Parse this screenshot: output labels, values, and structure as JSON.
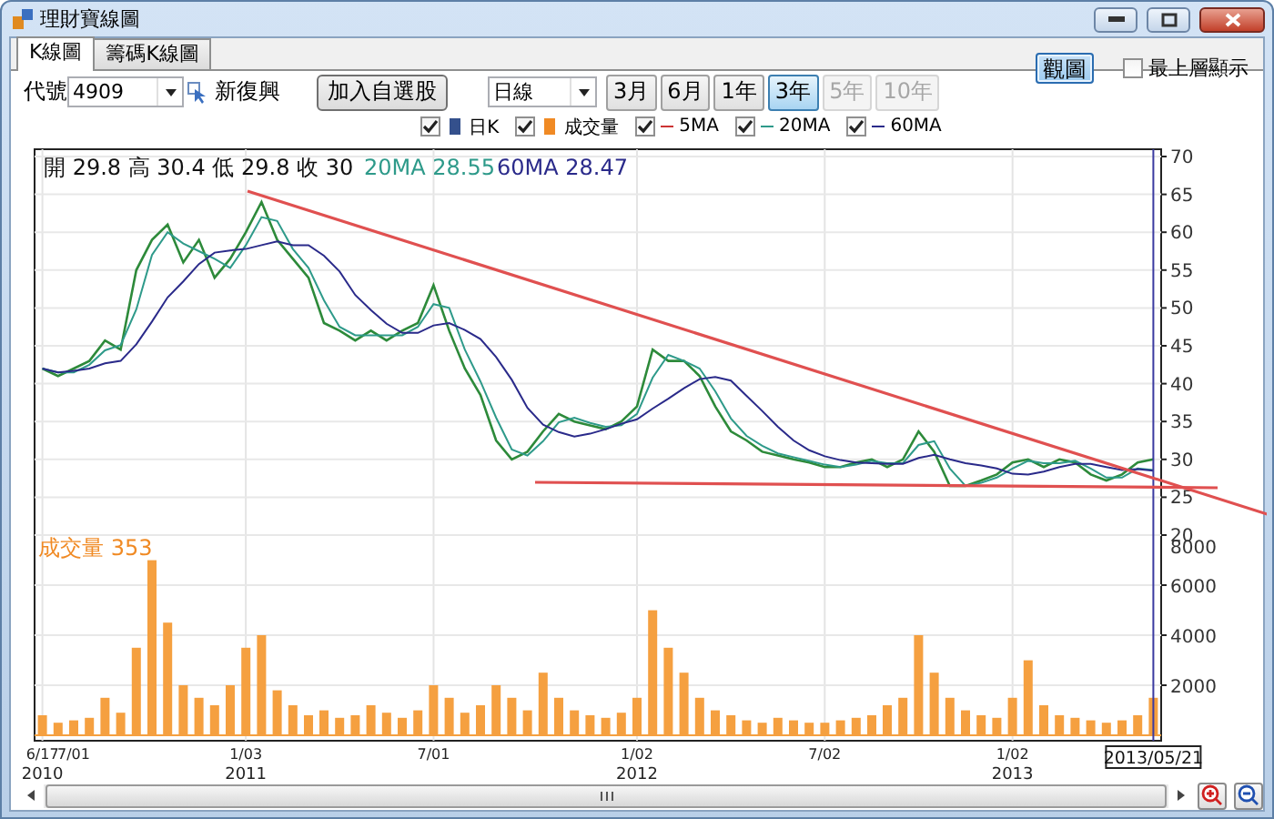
{
  "window": {
    "title": "理財寶線圖"
  },
  "tabs": [
    {
      "label": "K線圖",
      "selected": true
    },
    {
      "label": "籌碼K線圖",
      "selected": false
    }
  ],
  "view_button": {
    "label": "觀圖",
    "highlighted": true
  },
  "always_on_top": {
    "label": "最上層顯示",
    "checked": false
  },
  "toolbar": {
    "code_label": "代號",
    "code": {
      "value": "4909"
    },
    "stock_name": "新復興",
    "add_button": "加入自選股",
    "interval": {
      "value": "日線"
    },
    "periods": [
      {
        "label": "3月",
        "selected": false,
        "disabled": false
      },
      {
        "label": "6月",
        "selected": false,
        "disabled": false
      },
      {
        "label": "1年",
        "selected": false,
        "disabled": false
      },
      {
        "label": "3年",
        "selected": true,
        "disabled": false
      },
      {
        "label": "5年",
        "selected": false,
        "disabled": true
      },
      {
        "label": "10年",
        "selected": false,
        "disabled": true
      }
    ]
  },
  "legend": [
    {
      "label": "日K",
      "checked": true,
      "kind": "square",
      "color": "#34508c"
    },
    {
      "label": "成交量",
      "checked": true,
      "kind": "square",
      "color": "#f08a24"
    },
    {
      "label": "5MA",
      "checked": true,
      "kind": "line",
      "color": "#cc3333"
    },
    {
      "label": "20MA",
      "checked": true,
      "kind": "line",
      "color": "#2e9a8a"
    },
    {
      "label": "60MA",
      "checked": true,
      "kind": "line",
      "color": "#2a2a8a"
    }
  ],
  "price_panel": {
    "quote": "開 29.8 高 30.4 低 29.8 收 30",
    "ma_readings": [
      {
        "text": "20MA 28.55",
        "color": "#2e9a8a"
      },
      {
        "text": "60MA 28.47",
        "color": "#2a2a8a"
      }
    ],
    "cursor_label": "2013/05/21",
    "chart_data": {
      "type": "line",
      "ylim": [
        20,
        70
      ],
      "yticks": [
        20,
        25,
        30,
        35,
        40,
        45,
        50,
        55,
        60,
        65,
        70
      ],
      "grid": true,
      "series": [
        {
          "color": "#2d8a3a",
          "values": [
            42,
            41,
            42,
            43,
            45.7,
            44.5,
            55,
            59,
            61,
            56,
            59,
            54,
            56.5,
            60,
            64,
            59,
            56.5,
            54,
            48,
            47,
            45.7,
            47,
            45.7,
            47,
            48,
            53,
            47,
            42,
            38.5,
            32.5,
            30,
            31,
            33.7,
            36,
            35,
            34.5,
            34,
            35,
            37,
            44.5,
            43,
            43,
            41,
            37,
            33.7,
            32.5,
            31,
            30.5,
            30,
            29.6,
            29,
            29,
            29.6,
            30,
            29,
            30,
            33.7,
            31,
            26.5,
            26.5,
            27.2,
            28,
            29.6,
            30,
            29,
            30,
            29.6,
            28,
            27.2,
            28,
            29.6,
            30
          ]
        },
        {
          "color": "#2e9a8a",
          "values": [
            42,
            41.5,
            41.5,
            42.5,
            44.4,
            45.1,
            49.8,
            57,
            60,
            58.5,
            57.5,
            56.5,
            55.3,
            58.3,
            62,
            61.5,
            57.8,
            55.3,
            51,
            47.5,
            46.4,
            46.4,
            46.4,
            46.4,
            47.5,
            50.5,
            50,
            44.5,
            40.3,
            35.5,
            31.3,
            30.5,
            32.4,
            34.9,
            35.5,
            34.8,
            34.3,
            34.5,
            36,
            40.8,
            43.8,
            43,
            42,
            39,
            35.4,
            33.1,
            31.8,
            30.8,
            30.3,
            29.8,
            29.3,
            29,
            29.3,
            29.8,
            29.5,
            29.5,
            31.9,
            32.4,
            28.8,
            26.5,
            26.9,
            27.6,
            28.8,
            29.8,
            29.5,
            29.5,
            29.8,
            28.8,
            27.6,
            27.6,
            28.8,
            28.6
          ]
        },
        {
          "color": "#2a2a8a",
          "values": [
            42,
            41.5,
            41.7,
            42,
            42.7,
            43,
            45.2,
            48.2,
            51.4,
            53.5,
            55.8,
            57.3,
            57.6,
            57.8,
            58.3,
            58.8,
            58.3,
            58.3,
            56.9,
            54.8,
            51.7,
            49.7,
            47.9,
            46.7,
            46.7,
            47.7,
            48,
            47.1,
            45.9,
            43.5,
            40.5,
            36.8,
            34.6,
            33.6,
            33,
            33.4,
            34,
            34.7,
            35.3,
            36.7,
            38,
            39.4,
            40.6,
            40.9,
            40.4,
            38.4,
            36.4,
            34.3,
            32.5,
            31.2,
            30.4,
            29.9,
            29.6,
            29.5,
            29.4,
            29.4,
            30.2,
            30.6,
            30,
            29.5,
            29.2,
            28.8,
            28.1,
            28,
            28.4,
            29,
            29.4,
            29.4,
            29,
            28.6,
            28.7,
            28.5
          ]
        }
      ]
    }
  },
  "volume_panel": {
    "label": "成交量 353",
    "year_labels": [
      "2010",
      "2011",
      "2012",
      "2013"
    ],
    "chart_data": {
      "type": "bar",
      "ylim": [
        0,
        8000
      ],
      "yticks": [
        2000,
        4000,
        6000,
        8000
      ],
      "grid": true,
      "categories": [
        "6/17",
        null,
        "7/01",
        null,
        null,
        null,
        null,
        null,
        null,
        null,
        null,
        null,
        null,
        "1/03",
        null,
        null,
        null,
        null,
        null,
        null,
        null,
        null,
        null,
        null,
        null,
        "7/01",
        null,
        null,
        null,
        null,
        null,
        null,
        null,
        null,
        null,
        null,
        null,
        null,
        "1/02",
        null,
        null,
        null,
        null,
        null,
        null,
        null,
        null,
        null,
        null,
        null,
        "7/02",
        null,
        null,
        null,
        null,
        null,
        null,
        null,
        null,
        null,
        null,
        null,
        "1/02",
        null,
        null,
        null,
        null,
        null,
        null,
        null,
        null,
        null
      ],
      "series": [
        {
          "color": "#f5a040",
          "values": [
            800,
            500,
            600,
            700,
            1500,
            900,
            3500,
            7000,
            4500,
            2000,
            1500,
            1200,
            2000,
            3500,
            4000,
            1800,
            1200,
            800,
            1000,
            700,
            800,
            1200,
            900,
            700,
            1000,
            2000,
            1500,
            900,
            1200,
            2000,
            1500,
            1000,
            2500,
            1500,
            1000,
            800,
            700,
            900,
            1500,
            5000,
            3500,
            2500,
            1500,
            1000,
            800,
            600,
            500,
            700,
            600,
            500,
            500,
            600,
            700,
            800,
            1200,
            1500,
            4000,
            2500,
            1500,
            1000,
            800,
            700,
            1500,
            3000,
            1200,
            800,
            700,
            600,
            500,
            600,
            800,
            1500
          ]
        }
      ]
    }
  }
}
